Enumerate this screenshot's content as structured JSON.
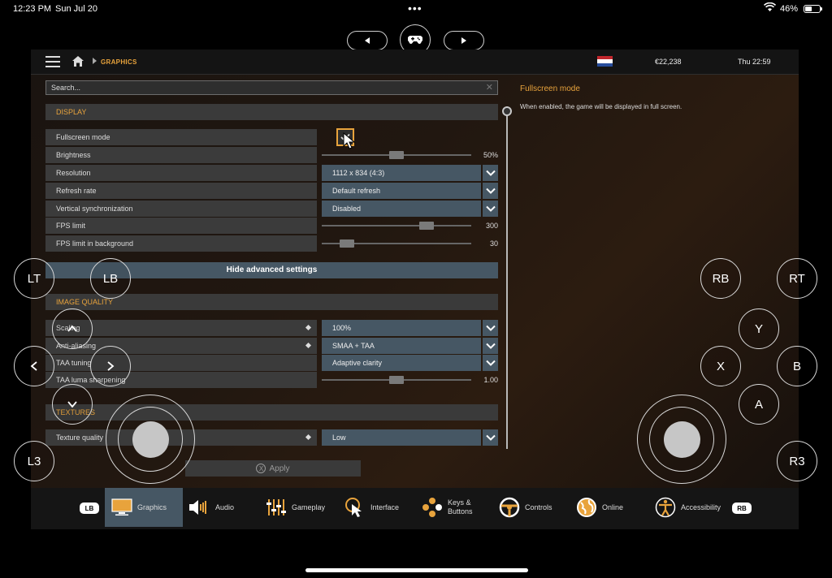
{
  "status_bar": {
    "time": "12:23 PM",
    "date": "Sun Jul 20",
    "battery": "46%"
  },
  "header": {
    "breadcrumb": "GRAPHICS",
    "money": "€22,238",
    "clock": "Thu 22:59"
  },
  "search": {
    "placeholder": "Search..."
  },
  "display": {
    "title": "DISPLAY",
    "fullscreen": {
      "label": "Fullscreen mode",
      "checked": true
    },
    "brightness": {
      "label": "Brightness",
      "value": "50%",
      "level": 0.5
    },
    "resolution": {
      "label": "Resolution",
      "value": "1112 x 834 (4:3)"
    },
    "refresh": {
      "label": "Refresh rate",
      "value": "Default refresh"
    },
    "vsync": {
      "label": "Vertical synchronization",
      "value": "Disabled"
    },
    "fps": {
      "label": "FPS limit",
      "value": "300",
      "level": 0.72
    },
    "fps_bg": {
      "label": "FPS limit in background",
      "value": "30",
      "level": 0.13
    }
  },
  "advanced_button": "Hide advanced settings",
  "image_quality": {
    "title": "IMAGE QUALITY",
    "scaling": {
      "label": "Scaling",
      "value": "100%"
    },
    "aa": {
      "label": "Anti-aliasing",
      "value": "SMAA + TAA"
    },
    "taa_tuning": {
      "label": "TAA tuning",
      "value": "Adaptive clarity"
    },
    "taa_sharp": {
      "label": "TAA luma sharpening",
      "value": "1.00",
      "level": 0.5
    }
  },
  "textures": {
    "title": "TEXTURES",
    "texture_quality": {
      "label": "Texture quality",
      "value": "Low"
    }
  },
  "info": {
    "title": "Fullscreen mode",
    "text": "When enabled, the game will be displayed in full screen."
  },
  "apply": "Apply",
  "tabs": {
    "lb": "LB",
    "rb": "RB",
    "graphics": "Graphics",
    "audio": "Audio",
    "gameplay": "Gameplay",
    "interface": "Interface",
    "keys_l1": "Keys &",
    "keys_l2": "Buttons",
    "controls": "Controls",
    "online": "Online",
    "accessibility": "Accessibility"
  },
  "controller": {
    "lt": "LT",
    "lb": "LB",
    "rb": "RB",
    "rt": "RT",
    "y": "Y",
    "x": "X",
    "b": "B",
    "a": "A",
    "l3": "L3",
    "r3": "R3"
  },
  "colors": {
    "accent": "#e8a33c",
    "control": "#465764",
    "row": "#3b3b3b"
  }
}
